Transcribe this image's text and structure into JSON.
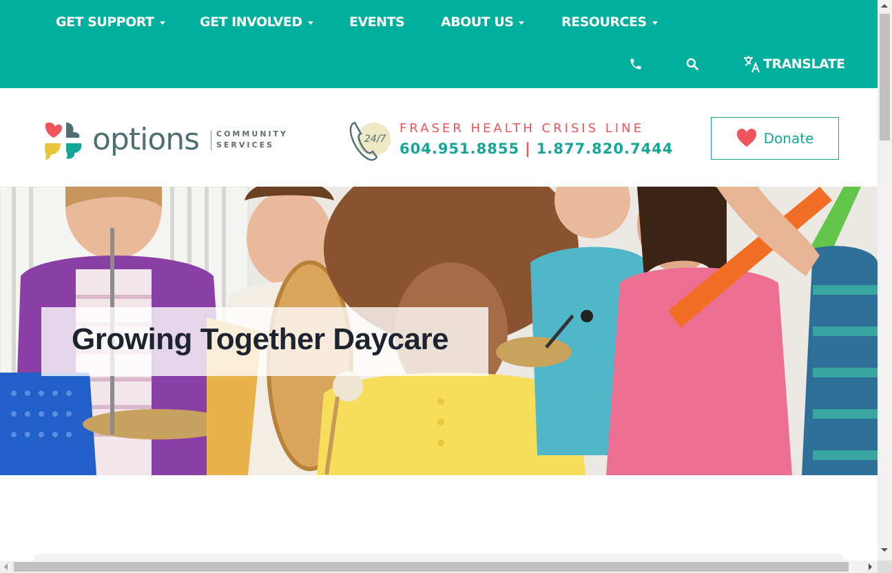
{
  "nav": {
    "items": [
      {
        "label": "GET SUPPORT",
        "has_dropdown": true
      },
      {
        "label": "GET INVOLVED",
        "has_dropdown": true
      },
      {
        "label": "EVENTS",
        "has_dropdown": false
      },
      {
        "label": "ABOUT US",
        "has_dropdown": true
      },
      {
        "label": "RESOURCES",
        "has_dropdown": true
      }
    ],
    "utility": {
      "phone_icon": "phone-icon",
      "search_icon": "search-icon",
      "translate_icon": "translate-icon",
      "translate_label": "TRANSLATE"
    }
  },
  "logo": {
    "wordmark": "options",
    "sub_line1": "COMMUNITY",
    "sub_line2": "SERVICES"
  },
  "crisis": {
    "badge": "24/7",
    "title": "FRASER HEALTH CRISIS LINE",
    "phone_local": "604.951.8855",
    "separator": "|",
    "phone_tollfree": "1.877.820.7444"
  },
  "donate": {
    "label": "Donate",
    "icon": "heart-icon"
  },
  "hero": {
    "title": "Growing Together Daycare"
  },
  "colors": {
    "brand_teal": "#00b09d",
    "teal_text": "#14a697",
    "coral": "#f0535a",
    "heading_dark": "#1d2430"
  }
}
